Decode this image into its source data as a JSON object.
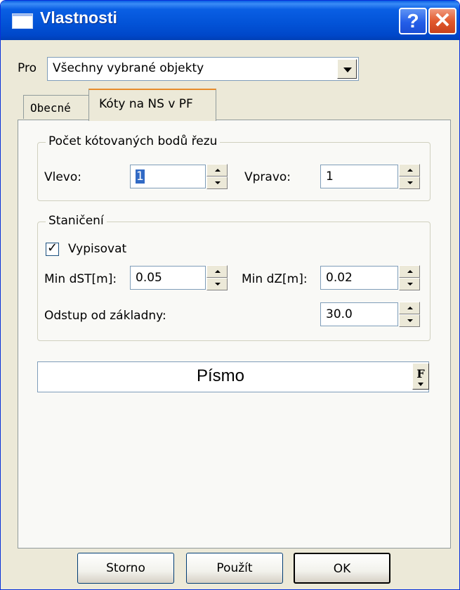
{
  "window": {
    "title": "Vlastnosti",
    "help_label": "?",
    "close_label": "✕"
  },
  "pro": {
    "label": "Pro",
    "value": "Všechny vybrané objekty"
  },
  "tabs": [
    {
      "label": "Obecné",
      "active": false
    },
    {
      "label": "Kóty na NS v PF",
      "active": true
    }
  ],
  "group_count": {
    "legend": "Počet kótovaných bodů řezu",
    "left_label": "Vlevo:",
    "left_value": "1",
    "right_label": "Vpravo:",
    "right_value": "1"
  },
  "group_station": {
    "legend": "Staničení",
    "checkbox_label": "Vypisovat",
    "checkbox_checked": true,
    "check_glyph": "✓",
    "min_dst_label": "Min dST[m]:",
    "min_dst_value": "0.05",
    "min_dz_label": "Min dZ[m]:",
    "min_dz_value": "0.02",
    "offset_label": "Odstup od základny:",
    "offset_value": "30.0"
  },
  "font": {
    "label": "Písmo",
    "button_glyph": "F"
  },
  "buttons": {
    "storno": "Storno",
    "apply": "Použít",
    "ok": "OK"
  },
  "colors": {
    "title_bar": "#0a5fe4",
    "face": "#ece9d8",
    "selection": "#316ac5"
  },
  "icons": {
    "window": "window-icon",
    "help": "help-icon",
    "close": "close-icon",
    "dropdown": "chevron-down-icon",
    "spin_up": "spin-up-icon",
    "spin_down": "spin-down-icon"
  }
}
